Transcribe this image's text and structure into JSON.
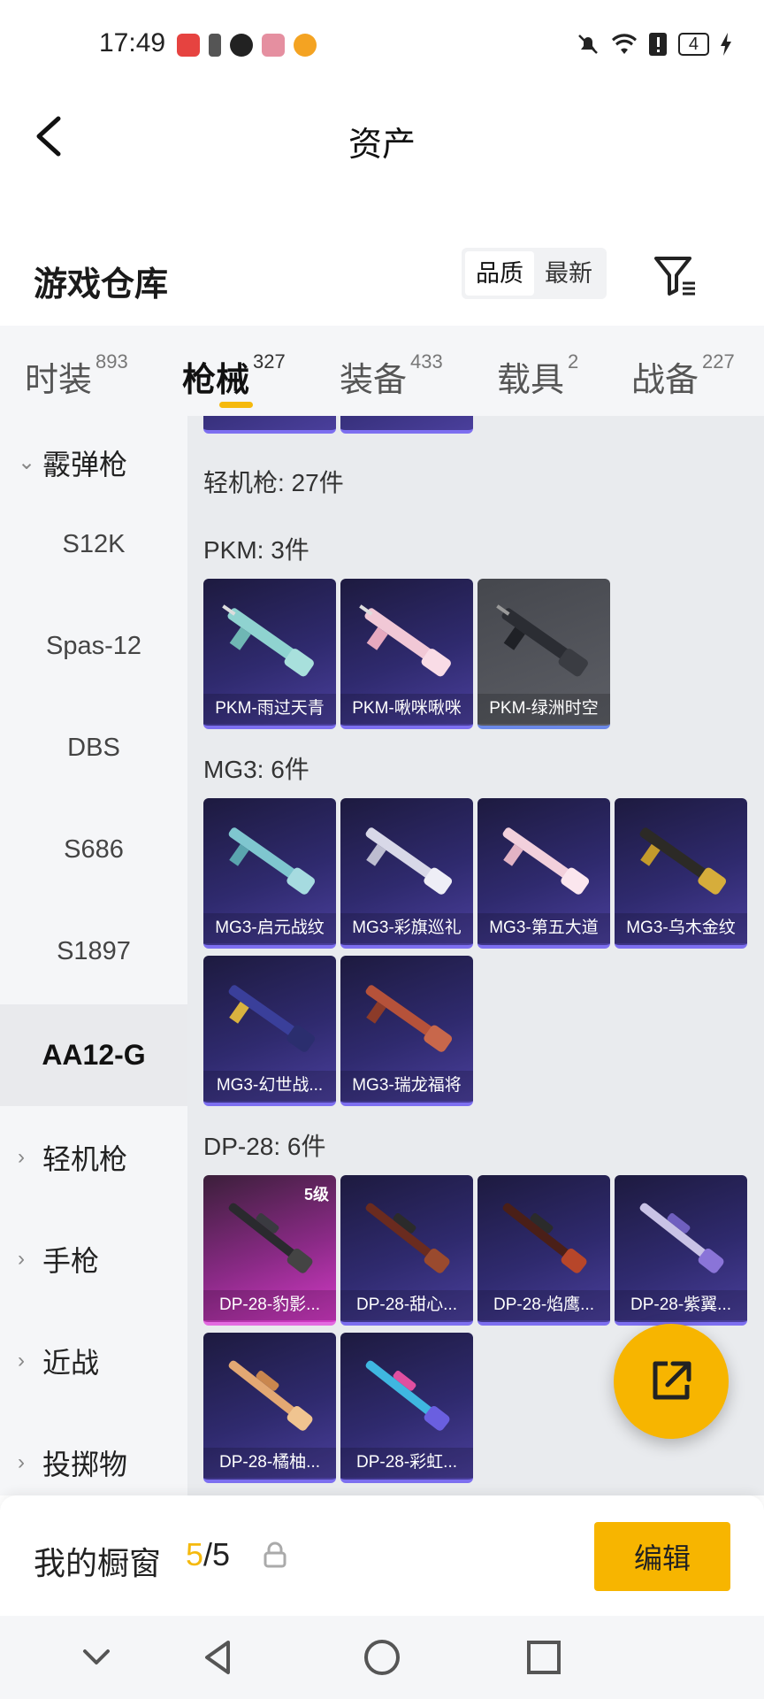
{
  "status_bar": {
    "time": "17:49",
    "battery": "4"
  },
  "header": {
    "title": "资产"
  },
  "warehouse": {
    "title": "游戏仓库",
    "sort_quality": "品质",
    "sort_newest": "最新"
  },
  "tabs": [
    {
      "label": "时装",
      "count": "893"
    },
    {
      "label": "枪械",
      "count": "327"
    },
    {
      "label": "装备",
      "count": "433"
    },
    {
      "label": "载具",
      "count": "2"
    },
    {
      "label": "战备",
      "count": "227"
    }
  ],
  "sidebar": {
    "group_shotgun": "霰弹枪",
    "items": [
      "S12K",
      "Spas-12",
      "DBS",
      "S686",
      "S1897",
      "AA12-G"
    ],
    "group_lmg": "轻机枪",
    "group_pistol": "手枪",
    "group_melee": "近战",
    "group_throw": "投掷物"
  },
  "content": {
    "lmg_total": "轻机枪: 27件",
    "pkm": {
      "title": "PKM: 3件",
      "items": [
        "PKM-雨过天青",
        "PKM-啾咪啾咪",
        "PKM-绿洲时空"
      ]
    },
    "mg3": {
      "title": "MG3: 6件",
      "items": [
        "MG3-启元战纹",
        "MG3-彩旗巡礼",
        "MG3-第五大道",
        "MG3-乌木金纹",
        "MG3-幻世战...",
        "MG3-瑞龙福将"
      ]
    },
    "dp28": {
      "title": "DP-28: 6件",
      "level_badge": "5级",
      "items": [
        "DP-28-豹影...",
        "DP-28-甜心...",
        "DP-28-焰鹰...",
        "DP-28-紫翼...",
        "DP-28-橘柚...",
        "DP-28-彩虹..."
      ]
    }
  },
  "showcase": {
    "title": "我的橱窗",
    "count_current": "5",
    "count_sep_total": "/5",
    "edit_label": "编辑"
  },
  "colors": {
    "accent": "#f7b500",
    "card_purple": "#2f2a6e",
    "card_pink": "#d43ac7",
    "card_grey": "#5d5f66"
  }
}
